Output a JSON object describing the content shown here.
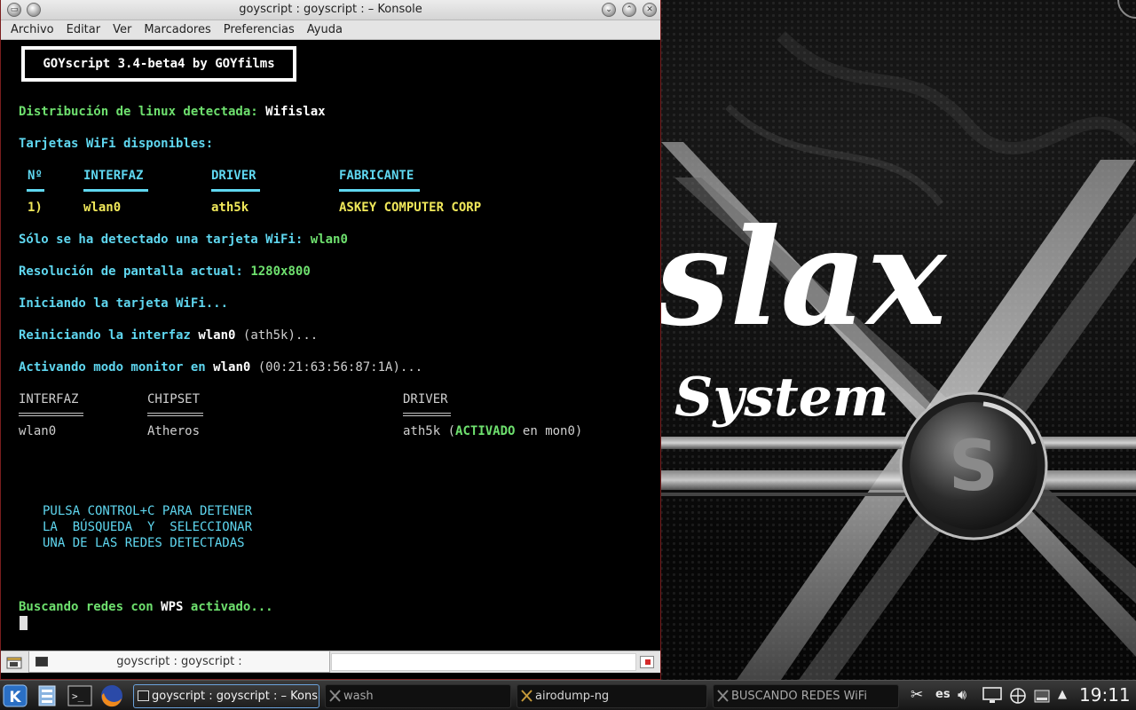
{
  "window": {
    "title": "goyscript : goyscript : – Konsole",
    "controls": [
      "minimize",
      "maximize",
      "close"
    ]
  },
  "menubar": [
    "Archivo",
    "Editar",
    "Ver",
    "Marcadores",
    "Preferencias",
    "Ayuda"
  ],
  "terminal": {
    "banner": "GOYscript 3.4-beta4 by GOYfilms",
    "distro_label": "Distribución de linux detectada:",
    "distro_value": "Wifislax",
    "cards_label": "Tarjetas WiFi disponibles:",
    "cards_table": {
      "headers": [
        "Nº",
        "INTERFAZ",
        "DRIVER",
        "FABRICANTE"
      ],
      "rows": [
        [
          "1)",
          "wlan0",
          "ath5k",
          "ASKEY COMPUTER CORP"
        ]
      ]
    },
    "single_card_label": "Sólo se ha detectado una tarjeta WiFi:",
    "single_card_value": "wlan0",
    "resolution_label": "Resolución de pantalla actual:",
    "resolution_value": "1280x800",
    "starting": "Iniciando la tarjeta WiFi...",
    "restart_prefix": "Reiniciando la interfaz",
    "restart_iface": "wlan0",
    "restart_suffix": "(ath5k)...",
    "monitor_prefix": "Activando modo monitor en",
    "monitor_iface": "wlan0",
    "monitor_suffix": "(00:21:63:56:87:1A)...",
    "iface_table": {
      "headers": [
        "INTERFAZ",
        "CHIPSET",
        "DRIVER"
      ],
      "row": {
        "iface": "wlan0",
        "chipset": "Atheros",
        "driver": "ath5k",
        "open": "(",
        "status": "ACTIVADO",
        "mon": "en mon0)"
      }
    },
    "instructions": [
      "PULSA CONTROL+C PARA DETENER",
      "LA  BÚSQUEDA  Y  SELECCIONAR",
      "UNA DE LAS REDES DETECTADAS"
    ],
    "searching_prefix": "Buscando redes con",
    "searching_wps": "WPS",
    "searching_suffix": "activado..."
  },
  "tabbar": {
    "tab_label": "goyscript : goyscript :"
  },
  "wallpaper": {
    "brand_text": "slax",
    "system_text": "System",
    "logo_letter": "S"
  },
  "taskbar": {
    "launchers": [
      "kde-menu-icon",
      "file-manager-icon",
      "terminal-icon",
      "firefox-icon"
    ],
    "tasks": [
      {
        "label": "goyscript : goyscript : – Kons",
        "active": true
      },
      {
        "label": "wash",
        "active": false
      },
      {
        "label": "airodump-ng",
        "active": false
      },
      {
        "label": "BUSCANDO REDES WiFi",
        "active": false
      }
    ],
    "keyboard_layout": "es",
    "clock": "19:11"
  },
  "colors": {
    "term_cyan": "#5fd7f0",
    "term_green": "#6ee06e",
    "term_yellow": "#f0e85a",
    "task_active_border": "#6aa1da"
  }
}
